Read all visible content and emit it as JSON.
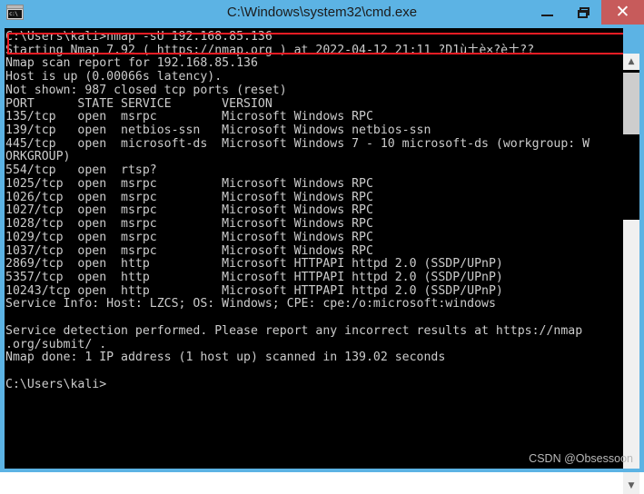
{
  "window": {
    "title": "C:\\Windows\\system32\\cmd.exe",
    "icon_name": "cmd-window-icon",
    "icon_text": "c:\\",
    "titlebar_color": "#5cb3e4",
    "close_button_color": "#c75b5b",
    "buttons": {
      "minimize_label": "—",
      "restore_label": "❐",
      "close_label": "✕"
    }
  },
  "annotation": {
    "redbox_color": "#ee1c24",
    "watermark": "CSDN @Obsessoon"
  },
  "scrollbar": {
    "up_arrow": "▲",
    "down_arrow": "▼"
  },
  "terminal": {
    "foreground": "#cccccc",
    "background": "#000000",
    "lines": [
      "C:\\Users\\kali>nmap -sU 192.168.85.136",
      "Starting Nmap 7.92 ( https://nmap.org ) at 2022-04-12 21:11 ?D1ù土è×?è土??",
      "Nmap scan report for 192.168.85.136",
      "Host is up (0.00066s latency).",
      "Not shown: 987 closed tcp ports (reset)",
      "PORT      STATE SERVICE       VERSION",
      "135/tcp   open  msrpc         Microsoft Windows RPC",
      "139/tcp   open  netbios-ssn   Microsoft Windows netbios-ssn",
      "445/tcp   open  microsoft-ds  Microsoft Windows 7 - 10 microsoft-ds (workgroup: W",
      "ORKGROUP)",
      "554/tcp   open  rtsp?",
      "1025/tcp  open  msrpc         Microsoft Windows RPC",
      "1026/tcp  open  msrpc         Microsoft Windows RPC",
      "1027/tcp  open  msrpc         Microsoft Windows RPC",
      "1028/tcp  open  msrpc         Microsoft Windows RPC",
      "1029/tcp  open  msrpc         Microsoft Windows RPC",
      "1037/tcp  open  msrpc         Microsoft Windows RPC",
      "2869/tcp  open  http          Microsoft HTTPAPI httpd 2.0 (SSDP/UPnP)",
      "5357/tcp  open  http          Microsoft HTTPAPI httpd 2.0 (SSDP/UPnP)",
      "10243/tcp open  http          Microsoft HTTPAPI httpd 2.0 (SSDP/UPnP)",
      "Service Info: Host: LZCS; OS: Windows; CPE: cpe:/o:microsoft:windows",
      "",
      "Service detection performed. Please report any incorrect results at https://nmap",
      ".org/submit/ .",
      "Nmap done: 1 IP address (1 host up) scanned in 139.02 seconds",
      "",
      "C:\\Users\\kali>"
    ]
  }
}
